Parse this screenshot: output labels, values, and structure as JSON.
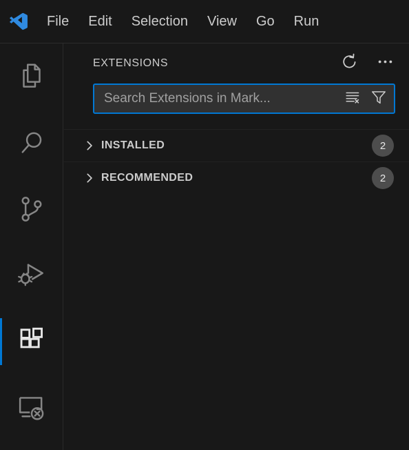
{
  "window": {
    "logo_icon": "vscode-logo-icon",
    "accent_color": "#0078d4",
    "background_color": "#181818"
  },
  "menubar": {
    "items": [
      {
        "label": "File"
      },
      {
        "label": "Edit"
      },
      {
        "label": "Selection"
      },
      {
        "label": "View"
      },
      {
        "label": "Go"
      },
      {
        "label": "Run"
      }
    ]
  },
  "activitybar": {
    "items": [
      {
        "name": "explorer",
        "icon": "files-icon",
        "active": false
      },
      {
        "name": "search",
        "icon": "search-icon",
        "active": false
      },
      {
        "name": "source-control",
        "icon": "source-control-icon",
        "active": false
      },
      {
        "name": "run-and-debug",
        "icon": "run-debug-icon",
        "active": false
      },
      {
        "name": "extensions",
        "icon": "extensions-icon",
        "active": true
      },
      {
        "name": "remote-explorer",
        "icon": "remote-explorer-icon",
        "active": false
      }
    ]
  },
  "sidebar": {
    "title": "EXTENSIONS",
    "actions": [
      {
        "name": "refresh",
        "icon": "refresh-icon"
      },
      {
        "name": "views-and-more-actions",
        "icon": "more-actions-icon"
      }
    ],
    "search": {
      "placeholder": "Search Extensions in Mark...",
      "value": "",
      "actions": [
        {
          "name": "clear-search-results",
          "icon": "clear-search-results-icon"
        },
        {
          "name": "filter",
          "icon": "filter-icon"
        }
      ]
    },
    "sections": [
      {
        "label": "INSTALLED",
        "count": "2",
        "expanded": false,
        "chevron": "chevron-right-icon"
      },
      {
        "label": "RECOMMENDED",
        "count": "2",
        "expanded": false,
        "chevron": "chevron-right-icon"
      }
    ]
  }
}
